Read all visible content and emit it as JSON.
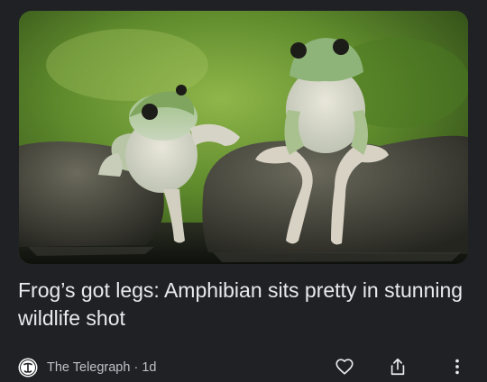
{
  "article": {
    "image_alt": "",
    "headline": "Frog’s got legs: Amphibian sits pretty in stunning wildlife shot",
    "source": "The Telegraph",
    "separator": "·",
    "age": "1d"
  },
  "icons": {
    "source_logo": "telegraph-logo-icon",
    "like": "heart-icon",
    "share": "share-icon",
    "more": "more-vert-icon"
  },
  "colors": {
    "background": "#202124",
    "text_primary": "#e8eaed",
    "text_secondary": "#bdc1c6"
  }
}
